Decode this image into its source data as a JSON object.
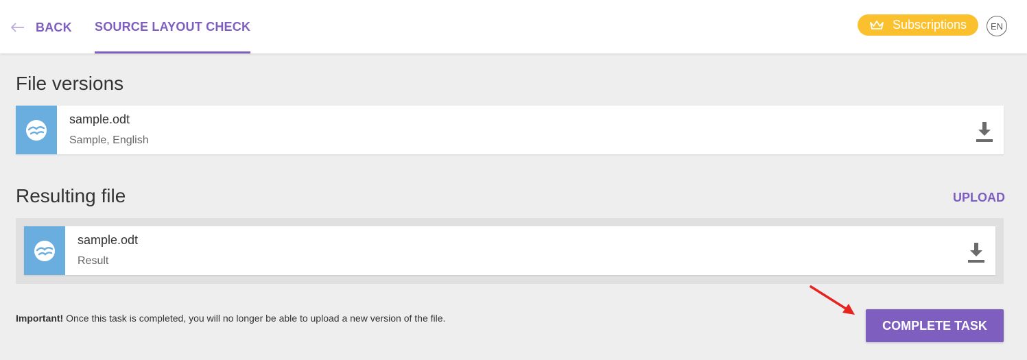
{
  "header": {
    "back_label": "BACK",
    "tab_label": "SOURCE LAYOUT CHECK",
    "subscriptions_label": "Subscriptions",
    "language": "EN"
  },
  "file_versions": {
    "title": "File versions",
    "items": [
      {
        "name": "sample.odt",
        "subtitle": "Sample, English",
        "icon": "openoffice-gull-icon"
      }
    ]
  },
  "resulting_file": {
    "title": "Resulting file",
    "upload_label": "UPLOAD",
    "items": [
      {
        "name": "sample.odt",
        "subtitle": "Result",
        "icon": "openoffice-gull-icon"
      }
    ]
  },
  "footer": {
    "note_bold": "Important!",
    "note_text": " Once this task is completed, you will no longer be able to upload a new version of the file.",
    "complete_label": "COMPLETE TASK"
  },
  "colors": {
    "accent": "#7e5fc0",
    "subscriptions": "#fbc02d",
    "file_icon_bg": "#6aaee0",
    "annotation_arrow": "#e8231f"
  }
}
